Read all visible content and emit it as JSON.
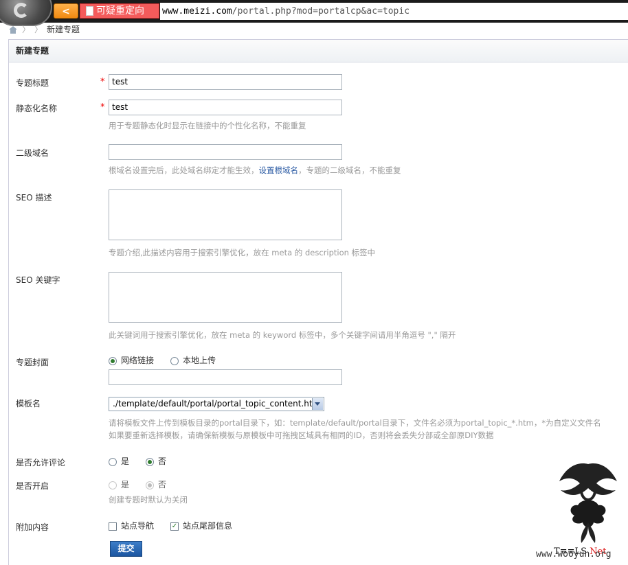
{
  "browser": {
    "warning_text": "可疑重定向",
    "url_host": "www.meizi.com",
    "url_path": "/portal.php?mod=portalcp&ac=topic"
  },
  "breadcrumb": {
    "separator": "〉",
    "current": "新建专题"
  },
  "panel": {
    "title": "新建专题"
  },
  "form": {
    "title_label": "专题标题",
    "title_value": "test",
    "static_label": "静态化名称",
    "static_value": "test",
    "static_tip": "用于专题静态化时显示在链接中的个性化名称，不能重复",
    "domain_label": "二级域名",
    "domain_value": "",
    "domain_tip_before": "根域名设置完后，此处域名绑定才能生效，",
    "domain_tip_link": "设置根域名",
    "domain_tip_after": "，专题的二级域名，不能重复",
    "seo_desc_label": "SEO 描述",
    "seo_desc_tip": "专题介绍,此描述内容用于搜索引擎优化，放在 meta 的 description 标签中",
    "seo_kw_label": "SEO 关键字",
    "seo_kw_tip": "此关键词用于搜索引擎优化，放在 meta 的 keyword 标签中，多个关键字间请用半角逗号 \",\" 隔开",
    "cover_label": "专题封面",
    "cover_opt_net": "网络链接",
    "cover_opt_local": "本地上传",
    "cover_selected": "网络链接",
    "template_label": "模板名",
    "template_value": "./template/default/portal/portal_topic_content.htm",
    "template_tip_1": "请将模板文件上传到模板目录的portal目录下，如：template/default/portal目录下，文件名必须为portal_topic_*.htm，*为自定义文件名",
    "template_tip_2": "如果要重新选择模板，请确保新模板与原模板中可拖拽区域具有相同的ID，否则将会丢失分部或全部原DIY数据",
    "comment_label": "是否允许评论",
    "comment_yes": "是",
    "comment_no": "否",
    "comment_selected": "否",
    "open_label": "是否开启",
    "open_yes": "是",
    "open_no": "否",
    "open_selected": "否",
    "open_tip": "创建专题时默认为关闭",
    "extra_label": "附加内容",
    "extra_nav": "站点导航",
    "extra_footer": "站点尾部信息",
    "extra_nav_checked": false,
    "extra_footer_checked": true,
    "submit_label": "提交"
  },
  "watermark": {
    "brand": "T≡≡LS",
    "brand_net": "Net",
    "site": "www.wooyun.org"
  },
  "colors": {
    "required": "#e00000",
    "tip": "#999999",
    "link": "#2a5aa3",
    "submit": "#1b55a0",
    "warning": "#f45b5b"
  }
}
